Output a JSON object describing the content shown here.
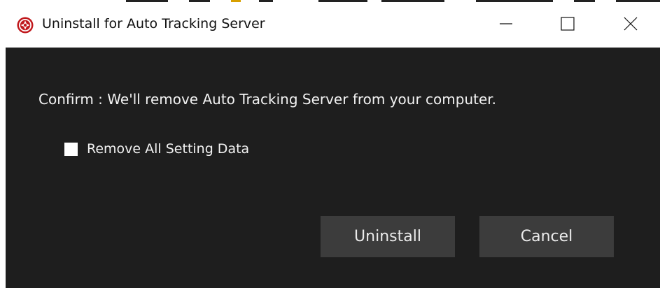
{
  "window": {
    "title": "Uninstall for Auto Tracking Server",
    "icon": "app-logo-icon",
    "controls": [
      "minimize-icon",
      "maximize-icon",
      "close-icon"
    ]
  },
  "dialog": {
    "message": "Confirm : We'll remove Auto Tracking Server from your computer.",
    "checkbox_label": "Remove All Setting Data",
    "checkbox_checked": false,
    "uninstall_label": "Uninstall",
    "cancel_label": "Cancel"
  },
  "colors": {
    "content_bg": "#1e1e1e",
    "button_bg": "#3c3c3c",
    "icon_red": "#c0181c"
  }
}
